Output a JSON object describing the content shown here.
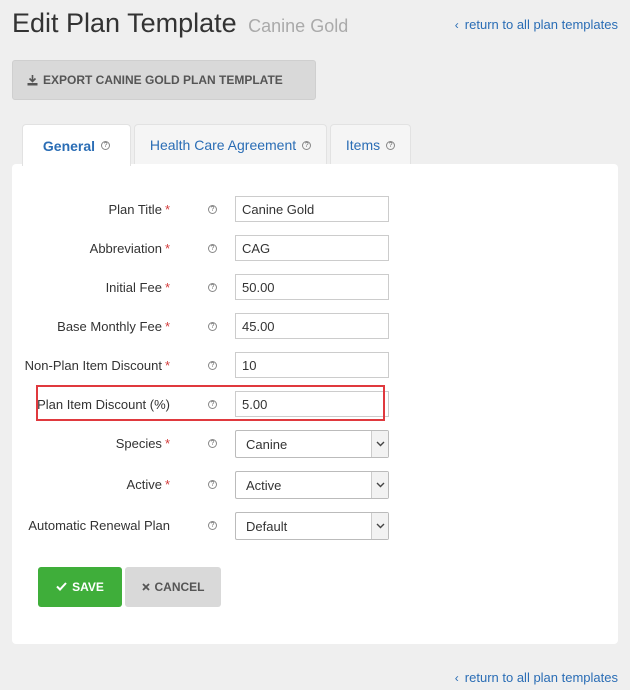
{
  "header": {
    "title": "Edit Plan Template",
    "subtitle": "Canine Gold",
    "return_link": "return to all plan templates"
  },
  "export_button": {
    "label": "EXPORT CANINE GOLD PLAN TEMPLATE"
  },
  "tabs": [
    {
      "label": "General",
      "active": true
    },
    {
      "label": "Health Care Agreement",
      "active": false
    },
    {
      "label": "Items",
      "active": false
    }
  ],
  "form": {
    "plan_title": {
      "label": "Plan Title",
      "required": true,
      "value": "Canine Gold"
    },
    "abbreviation": {
      "label": "Abbreviation",
      "required": true,
      "value": "CAG"
    },
    "initial_fee": {
      "label": "Initial Fee",
      "required": true,
      "value": "50.00"
    },
    "base_monthly_fee": {
      "label": "Base Monthly Fee",
      "required": true,
      "value": "45.00"
    },
    "non_plan_item_discount": {
      "label": "Non-Plan Item Discount",
      "required": true,
      "value": "10"
    },
    "plan_item_discount": {
      "label": "Plan Item Discount (%)",
      "required": false,
      "value": "5.00"
    },
    "species": {
      "label": "Species",
      "required": true,
      "value": "Canine"
    },
    "active": {
      "label": "Active",
      "required": true,
      "value": "Active"
    },
    "automatic_renewal_plan": {
      "label": "Automatic Renewal Plan",
      "required": false,
      "value": "Default"
    }
  },
  "required_marker": "*",
  "help_glyph": "?",
  "buttons": {
    "save": "SAVE",
    "cancel": "CANCEL"
  },
  "colors": {
    "link": "#2a6db5",
    "save": "#3fae3a",
    "required": "#d23b3b",
    "highlight": "#e0393e"
  }
}
